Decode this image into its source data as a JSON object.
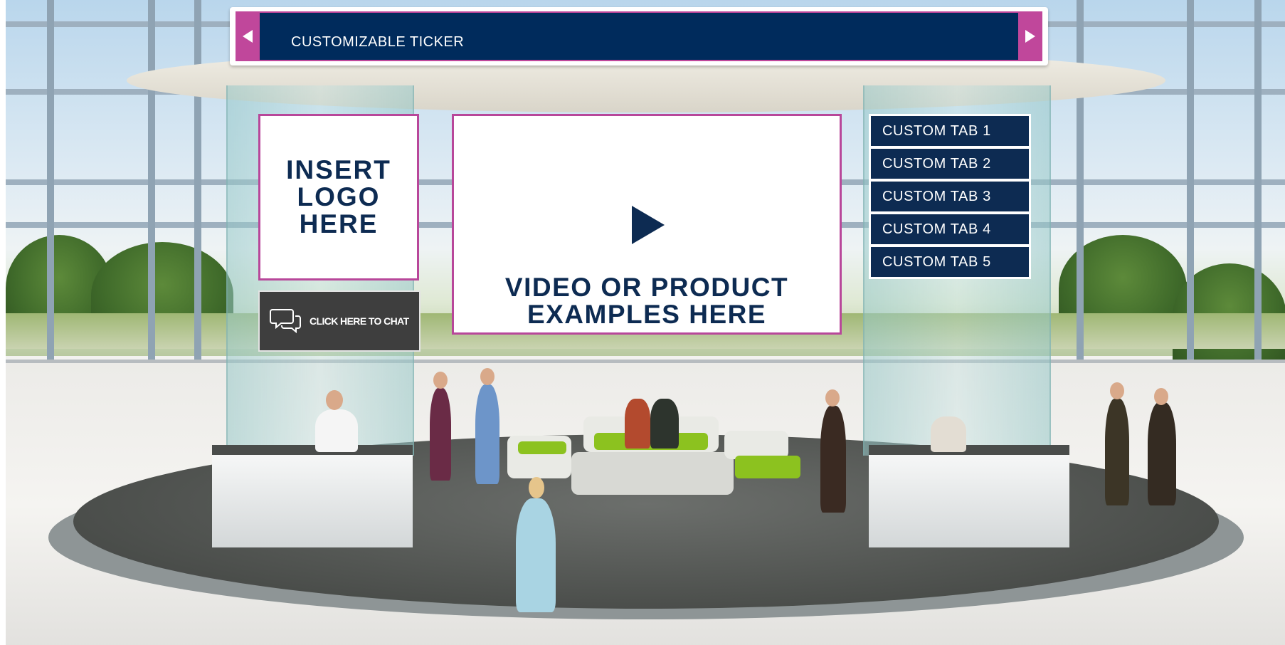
{
  "ticker": {
    "text": "CUSTOMIZABLE TICKER",
    "prev_icon": "triangle-left-icon",
    "next_icon": "triangle-right-icon"
  },
  "logo_panel": {
    "text": "INSERT\nLOGO\nHERE"
  },
  "chat": {
    "label": "CLICK HERE TO CHAT",
    "icon": "chat-bubbles-icon"
  },
  "video_panel": {
    "text": "VIDEO OR PRODUCT\nEXAMPLES HERE",
    "icon": "play-icon"
  },
  "tabs": [
    {
      "label": "CUSTOM TAB 1"
    },
    {
      "label": "CUSTOM TAB 2"
    },
    {
      "label": "CUSTOM TAB 3"
    },
    {
      "label": "CUSTOM TAB 4"
    },
    {
      "label": "CUSTOM TAB 5"
    }
  ],
  "colors": {
    "navy": "#0d2b52",
    "ticker_navy": "#002b5c",
    "magenta": "#c0479b",
    "chat_gray": "#3e3e3e",
    "accent_green": "#8cc21f"
  }
}
